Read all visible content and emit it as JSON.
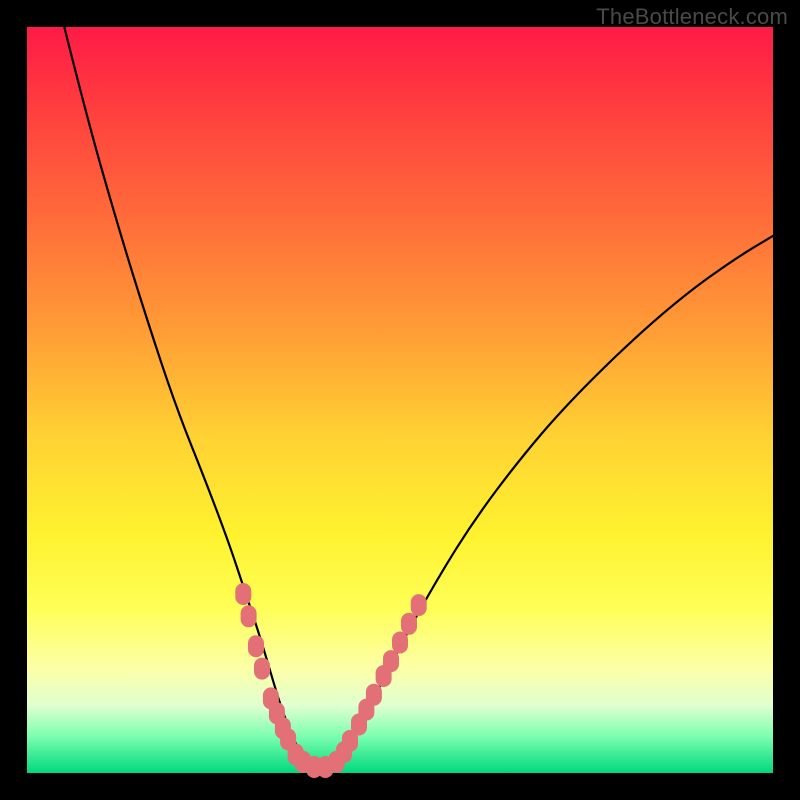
{
  "watermark": "TheBottleneck.com",
  "chart_data": {
    "type": "line",
    "title": "",
    "xlabel": "",
    "ylabel": "",
    "xlim": [
      0,
      100
    ],
    "ylim": [
      0,
      100
    ],
    "series": [
      {
        "name": "bottleneck-curve",
        "x": [
          5,
          8,
          12,
          16,
          20,
          24,
          27,
          29,
          31,
          32.5,
          34,
          35.5,
          37,
          38.5,
          40,
          42,
          44,
          46,
          50,
          55,
          60,
          66,
          72,
          80,
          88,
          95,
          100
        ],
        "y": [
          100,
          88,
          74,
          61,
          49,
          39,
          31,
          25,
          19,
          14,
          9,
          5,
          2,
          0.5,
          0.5,
          2,
          5,
          9,
          17,
          26,
          34,
          42,
          49,
          57,
          64,
          69,
          72
        ]
      }
    ],
    "markers": {
      "name": "highlight-dots",
      "color": "#e37076",
      "points": [
        {
          "x": 29.0,
          "y": 24.0
        },
        {
          "x": 29.7,
          "y": 21.0
        },
        {
          "x": 30.7,
          "y": 17.0
        },
        {
          "x": 31.5,
          "y": 14.0
        },
        {
          "x": 32.7,
          "y": 10.0
        },
        {
          "x": 33.5,
          "y": 8.0
        },
        {
          "x": 34.3,
          "y": 6.0
        },
        {
          "x": 35.0,
          "y": 4.5
        },
        {
          "x": 36.0,
          "y": 2.5
        },
        {
          "x": 37.0,
          "y": 1.5
        },
        {
          "x": 38.5,
          "y": 0.8
        },
        {
          "x": 40.0,
          "y": 0.8
        },
        {
          "x": 41.5,
          "y": 1.5
        },
        {
          "x": 42.5,
          "y": 2.8
        },
        {
          "x": 43.3,
          "y": 4.3
        },
        {
          "x": 44.5,
          "y": 6.5
        },
        {
          "x": 45.5,
          "y": 8.5
        },
        {
          "x": 46.5,
          "y": 10.5
        },
        {
          "x": 47.8,
          "y": 13.0
        },
        {
          "x": 48.8,
          "y": 15.0
        },
        {
          "x": 50.0,
          "y": 17.5
        },
        {
          "x": 51.2,
          "y": 20.0
        },
        {
          "x": 52.5,
          "y": 22.5
        }
      ]
    }
  }
}
